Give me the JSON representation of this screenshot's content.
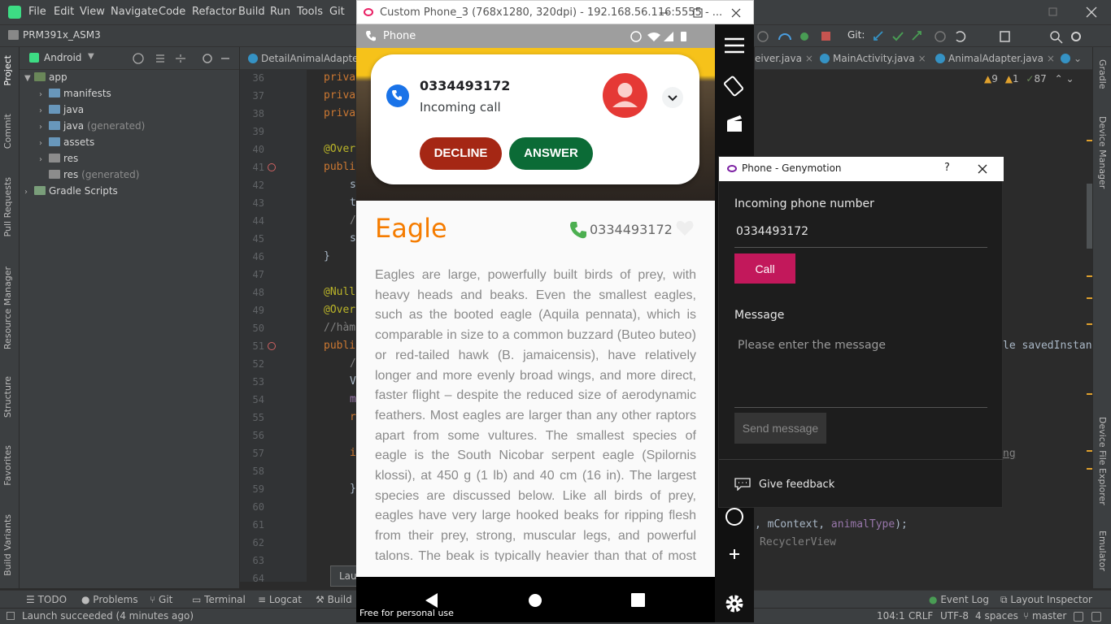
{
  "ide": {
    "menu": [
      "File",
      "Edit",
      "View",
      "Navigate",
      "Code",
      "Refactor",
      "Build",
      "Run",
      "Tools",
      "Git"
    ],
    "project_name": "PRM391x_ASM3",
    "git_label": "Git:",
    "project_view": "Android",
    "left_tabs": [
      "Project",
      "Commit",
      "Pull Requests",
      "Resource Manager",
      "Structure",
      "Favorites",
      "Build Variants"
    ],
    "right_tabs": [
      "Gradle",
      "Device Manager",
      "Device File Explorer",
      "Emulator"
    ],
    "tree": [
      {
        "label": "app",
        "extra": ""
      },
      {
        "label": "manifests",
        "extra": ""
      },
      {
        "label": "java",
        "extra": ""
      },
      {
        "label": "java",
        "extra": "(generated)"
      },
      {
        "label": "assets",
        "extra": ""
      },
      {
        "label": "res",
        "extra": ""
      },
      {
        "label": "res",
        "extra": "(generated)"
      },
      {
        "label": "Gradle Scripts",
        "extra": ""
      }
    ],
    "editor_tabs": [
      "DetailAnimalAdapter.j",
      "eiver.java",
      "MainActivity.java",
      "AnimalAdapter.java"
    ],
    "inspections": {
      "warnings": "9",
      "errors": "1",
      "weak": "87"
    },
    "line_numbers": [
      "36",
      "37",
      "38",
      "39",
      "40",
      "41",
      "42",
      "43",
      "44",
      "45",
      "46",
      "47",
      "48",
      "49",
      "50",
      "51",
      "52",
      "53",
      "54",
      "55",
      "56",
      "57",
      "58",
      "59",
      "60",
      "61",
      "62",
      "63",
      "64"
    ],
    "code": {
      "l36": "priva",
      "l37": "priva",
      "l38": "priva",
      "l40": "@Over",
      "l41": "publi",
      "l42": "s",
      "l43": "t",
      "l44": "/",
      "l45": "s",
      "l46": "}",
      "l48": "@Null",
      "l49": "@Over",
      "l50": "//hàm",
      "l51": "publi",
      "l52": "/",
      "l53": "V",
      "l54": "m",
      "l55": "r",
      "l57": "i",
      "l59": "}",
      "r51": "le savedInstan",
      "r57": "ng",
      "r61_a": ", mContext, ",
      "r61_b": "animalType",
      "r61_c": ");",
      "r62": "RecyclerView"
    },
    "launch_stub": "Lau",
    "bottom_tabs": [
      "TODO",
      "Problems",
      "Git",
      "Terminal",
      "Logcat",
      "Build",
      "Event Log",
      "Layout Inspector"
    ],
    "status": {
      "message": "Launch succeeded (4 minutes ago)",
      "position": "104:1",
      "line_sep": "CRLF",
      "encoding": "UTF-8",
      "indent": "4 spaces",
      "branch": "master"
    }
  },
  "emulator": {
    "window_title": "Custom Phone_3 (768x1280, 320dpi) - 192.168.56.116:5555 - ...",
    "status_app": "Phone",
    "notification": {
      "number": "0334493172",
      "subtitle": "Incoming call",
      "decline": "DECLINE",
      "answer": "ANSWER"
    },
    "animal": {
      "name": "Eagle",
      "phone": "0334493172",
      "description": "Eagles are large, powerfully built birds of prey, with heavy heads and beaks. Even the smallest eagles, such as the booted eagle (Aquila pennata), which is comparable in size to a common buzzard (Buteo buteo) or red-tailed hawk (B. jamaicensis), have relatively longer and more evenly broad wings, and more direct, faster flight – despite the reduced size of aerodynamic feathers. Most eagles are larger than any other raptors apart from some vultures. The smallest species of eagle is the South Nicobar serpent eagle (Spilornis klossi), at 450 g (1 lb) and 40 cm (16 in). The largest species are discussed below. Like all birds of prey, eagles have very large hooked beaks for ripping flesh from their prey, strong, muscular legs, and powerful talons. The beak is typically heavier than that of most other birds of prey. Eagles' eyes are extremely powerful. It is estimated that the martial eagle, whose"
    },
    "watermark": "Free for personal use"
  },
  "phone_dialog": {
    "title": "Phone - Genymotion",
    "help": "?",
    "incoming_label": "Incoming phone number",
    "incoming_value": "0334493172",
    "call_button": "Call",
    "message_label": "Message",
    "message_placeholder": "Please enter the message",
    "send_button": "Send message",
    "feedback": "Give feedback"
  },
  "colors": {
    "decline": "#a52714",
    "answer": "#0b6b36",
    "call": "#c2185b",
    "title_orange": "#f57c00",
    "phone_green": "#4caf50"
  }
}
